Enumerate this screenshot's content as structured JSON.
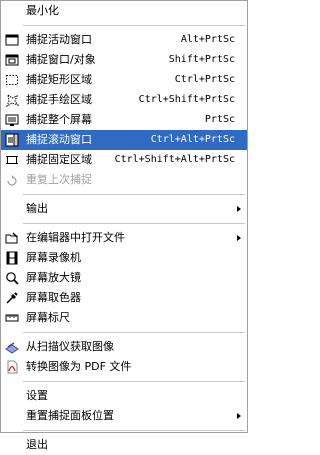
{
  "menu": {
    "items": [
      {
        "type": "item",
        "icon": "none",
        "label": "最小化",
        "name": "minimize"
      },
      {
        "type": "sep"
      },
      {
        "type": "item",
        "icon": "window-icon",
        "label": "捕捉活动窗口",
        "shortcut": "Alt+PrtSc",
        "name": "capture-active-window"
      },
      {
        "type": "item",
        "icon": "window-object-icon",
        "label": "捕捉窗口/对象",
        "shortcut": "Shift+PrtSc",
        "name": "capture-window-object"
      },
      {
        "type": "item",
        "icon": "rect-region-icon",
        "label": "捕捉矩形区域",
        "shortcut": "Ctrl+PrtSc",
        "name": "capture-rect-region"
      },
      {
        "type": "item",
        "icon": "freehand-region-icon",
        "label": "捕捉手绘区域",
        "shortcut": "Ctrl+Shift+PrtSc",
        "name": "capture-freehand-region"
      },
      {
        "type": "item",
        "icon": "fullscreen-icon",
        "label": "捕捉整个屏幕",
        "shortcut": "PrtSc",
        "name": "capture-full-screen"
      },
      {
        "type": "item",
        "icon": "scroll-window-icon",
        "label": "捕捉滚动窗口",
        "shortcut": "Ctrl+Alt+PrtSc",
        "name": "capture-scrolling-window",
        "selected": true
      },
      {
        "type": "item",
        "icon": "fixed-region-icon",
        "label": "捕捉固定区域",
        "shortcut": "Ctrl+Shift+Alt+PrtSc",
        "name": "capture-fixed-region"
      },
      {
        "type": "item",
        "icon": "repeat-icon",
        "label": "重复上次捕捉",
        "name": "repeat-last-capture",
        "disabled": true
      },
      {
        "type": "sep"
      },
      {
        "type": "item",
        "icon": "none",
        "label": "输出",
        "name": "output",
        "submenu": true
      },
      {
        "type": "sep"
      },
      {
        "type": "item",
        "icon": "open-editor-icon",
        "label": "在编辑器中打开文件",
        "name": "open-in-editor",
        "submenu": true
      },
      {
        "type": "item",
        "icon": "film-icon",
        "label": "屏幕录像机",
        "name": "screen-recorder"
      },
      {
        "type": "item",
        "icon": "magnifier-icon",
        "label": "屏幕放大镜",
        "name": "screen-magnifier"
      },
      {
        "type": "item",
        "icon": "eyedropper-icon",
        "label": "屏幕取色器",
        "name": "screen-color-picker"
      },
      {
        "type": "item",
        "icon": "ruler-icon",
        "label": "屏幕标尺",
        "name": "screen-ruler"
      },
      {
        "type": "sep"
      },
      {
        "type": "item",
        "icon": "scanner-icon",
        "label": "从扫描仪获取图像",
        "name": "acquire-from-scanner"
      },
      {
        "type": "item",
        "icon": "pdf-icon",
        "label": "转换图像为 PDF 文件",
        "name": "convert-to-pdf"
      },
      {
        "type": "sep"
      },
      {
        "type": "item",
        "icon": "none",
        "label": "设置",
        "name": "settings"
      },
      {
        "type": "item",
        "icon": "none",
        "label": "重置捕捉面板位置",
        "name": "reset-panel-position",
        "submenu": true
      },
      {
        "type": "sep"
      },
      {
        "type": "item",
        "icon": "none",
        "label": "退出",
        "name": "exit"
      }
    ]
  }
}
